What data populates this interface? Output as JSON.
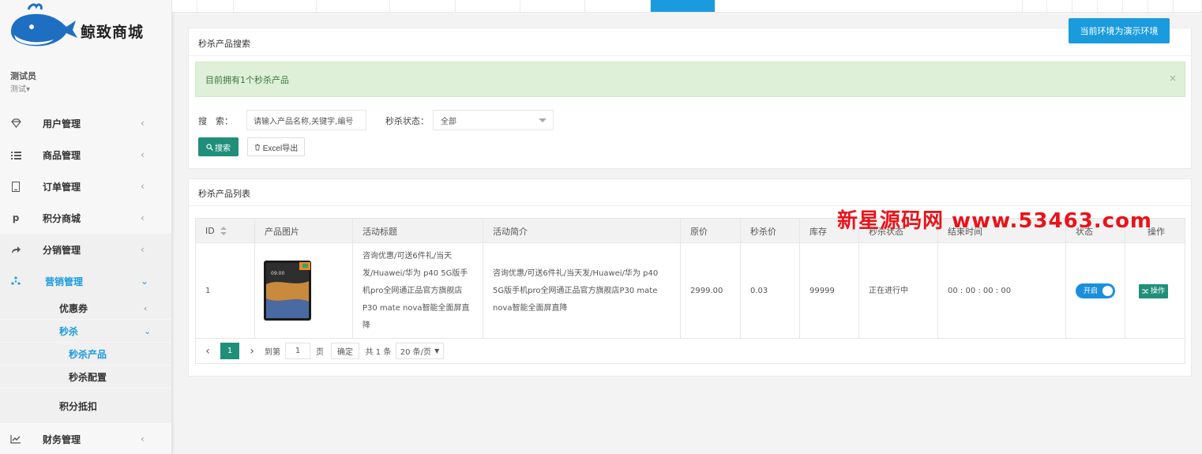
{
  "brand": {
    "name": "鲸致商城"
  },
  "user": {
    "name": "测试员",
    "role": "测试▾"
  },
  "sidebar": {
    "items": [
      {
        "label": "用户管理",
        "icon": "diamond-icon"
      },
      {
        "label": "商品管理",
        "icon": "list-icon"
      },
      {
        "label": "订单管理",
        "icon": "file-icon"
      },
      {
        "label": "积分商城",
        "icon": "pinterest-icon"
      },
      {
        "label": "分销管理",
        "icon": "share-icon"
      },
      {
        "label": "营销管理",
        "icon": "asterisk-icon"
      },
      {
        "label": "财务管理",
        "icon": "line-chart-icon"
      }
    ],
    "sub": {
      "coupon": "优惠券",
      "seckill": "秒杀",
      "seckill_product": "秒杀产品",
      "seckill_config": "秒杀配置",
      "points_deduct": "积分抵扣"
    }
  },
  "demo_button": "当前环境为演示环境",
  "search_panel": {
    "title": "秒杀产品搜索",
    "alert": "目前拥有1个秒杀产品",
    "search_label": "搜　索：",
    "search_placeholder": "请输入产品名称,关键字,编号",
    "status_label": "秒杀状态：",
    "status_value": "全部",
    "search_button": "搜索",
    "excel_button": "Excel导出"
  },
  "list_panel": {
    "title": "秒杀产品列表",
    "columns": [
      "ID",
      "产品图片",
      "活动标题",
      "活动简介",
      "原价",
      "秒杀价",
      "库存",
      "秒杀状态",
      "结束时间",
      "状态",
      "操作"
    ],
    "rows": [
      {
        "id": "1",
        "title_lines": [
          "咨询优惠/可送6件礼/当天",
          "发/Huawei/华为 p40 5G版手",
          "机pro全网通正品官方旗舰店",
          "P30 mate nova智能全面屏直",
          "降"
        ],
        "intro_lines": [
          "咨询优惠/可送6件礼/当天发/Huawei/华为 p40",
          "5G版手机pro全网通正品官方旗舰店P30 mate",
          "nova智能全面屏直降"
        ],
        "original_price": "2999.00",
        "seckill_price": "0.03",
        "stock": "99999",
        "status_text": "正在进行中",
        "end_time": "00 : 00 : 00 : 00",
        "toggle_label": "开启",
        "op_label": "操作"
      }
    ]
  },
  "pagination": {
    "current": "1",
    "goto_label": "到第",
    "goto_value": "1",
    "page_unit": "页",
    "confirm": "确定",
    "total": "共 1 条",
    "page_size": "20 条/页"
  },
  "watermark": "新星源码网 www.53463.com",
  "colors": {
    "primary": "#1a9bde",
    "green": "#1f8f7a",
    "alert_bg": "#dff0d8"
  }
}
